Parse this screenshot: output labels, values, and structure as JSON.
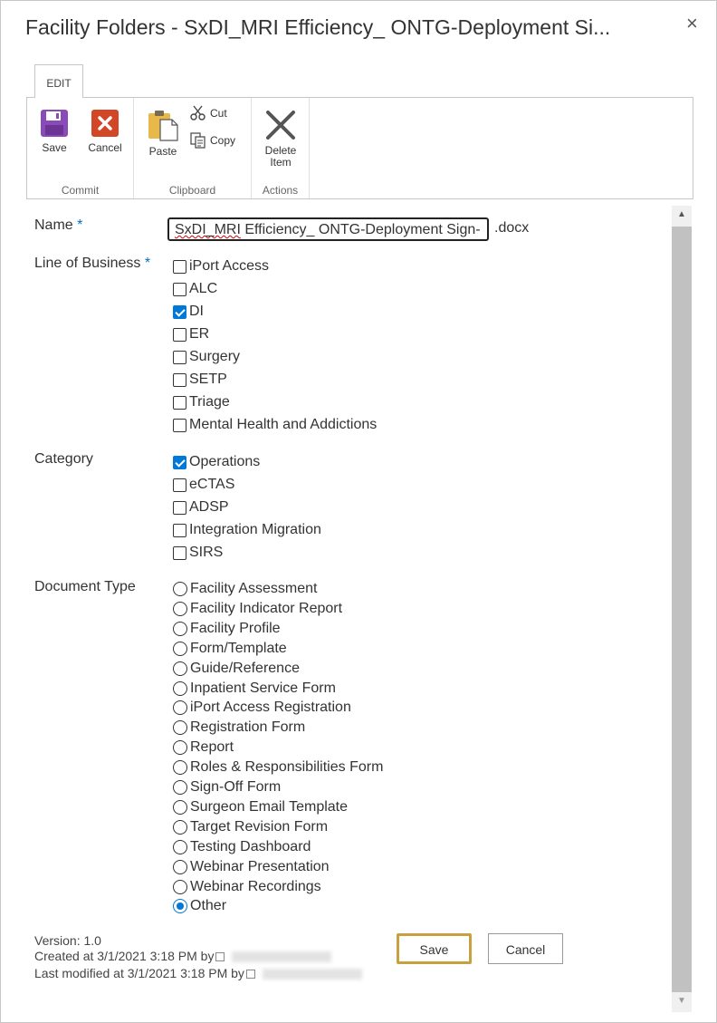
{
  "dialog": {
    "title": "Facility Folders - SxDI_MRI Efficiency_ ONTG-Deployment Si...",
    "close_glyph": "×"
  },
  "ribbon": {
    "tab": "EDIT",
    "groups": {
      "commit": "Commit",
      "clipboard": "Clipboard",
      "actions": "Actions"
    },
    "buttons": {
      "save": "Save",
      "cancel": "Cancel",
      "paste": "Paste",
      "cut": "Cut",
      "copy": "Copy",
      "delete_line1": "Delete",
      "delete_line2": "Item"
    },
    "icons": [
      "save-icon",
      "cancel-icon",
      "paste-icon",
      "cut-icon",
      "copy-icon",
      "delete-icon"
    ],
    "colors": {
      "save": "#8a4bb8",
      "cancel": "#d24726",
      "paste": "#e8b84a"
    }
  },
  "form": {
    "name": {
      "label": "Name",
      "required_mark": "*",
      "value_highlight": "SxDI_MRI",
      "value_rest": " Efficiency_ ONTG-Deployment Sign-",
      "extension": ".docx"
    },
    "line_of_business": {
      "label": "Line of Business",
      "required_mark": "*",
      "options": [
        {
          "label": "iPort Access",
          "checked": false
        },
        {
          "label": "ALC",
          "checked": false
        },
        {
          "label": "DI",
          "checked": true
        },
        {
          "label": "ER",
          "checked": false
        },
        {
          "label": "Surgery",
          "checked": false
        },
        {
          "label": "SETP",
          "checked": false
        },
        {
          "label": "Triage",
          "checked": false
        },
        {
          "label": "Mental Health and Addictions",
          "checked": false
        }
      ]
    },
    "category": {
      "label": "Category",
      "options": [
        {
          "label": "Operations",
          "checked": true
        },
        {
          "label": "eCTAS",
          "checked": false
        },
        {
          "label": "ADSP",
          "checked": false
        },
        {
          "label": "Integration Migration",
          "checked": false
        },
        {
          "label": "SIRS",
          "checked": false
        }
      ]
    },
    "document_type": {
      "label": "Document Type",
      "selected": "Other",
      "options": [
        "Facility Assessment",
        "Facility Indicator Report",
        "Facility Profile",
        "Form/Template",
        "Guide/Reference",
        "Inpatient Service Form",
        "iPort Access Registration",
        "Registration Form",
        "Report",
        "Roles & Responsibilities Form",
        "Sign-Off Form",
        "Surgeon Email Template",
        "Target Revision Form",
        "Testing Dashboard",
        "Webinar Presentation",
        "Webinar Recordings",
        "Other"
      ]
    }
  },
  "footer": {
    "version": "Version: 1.0",
    "created": "Created at 3/1/2021 3:18 PM  by",
    "modified": "Last modified at 3/1/2021 3:18 PM  by",
    "save_label": "Save",
    "cancel_label": "Cancel"
  },
  "accent_color": "#0078d7"
}
